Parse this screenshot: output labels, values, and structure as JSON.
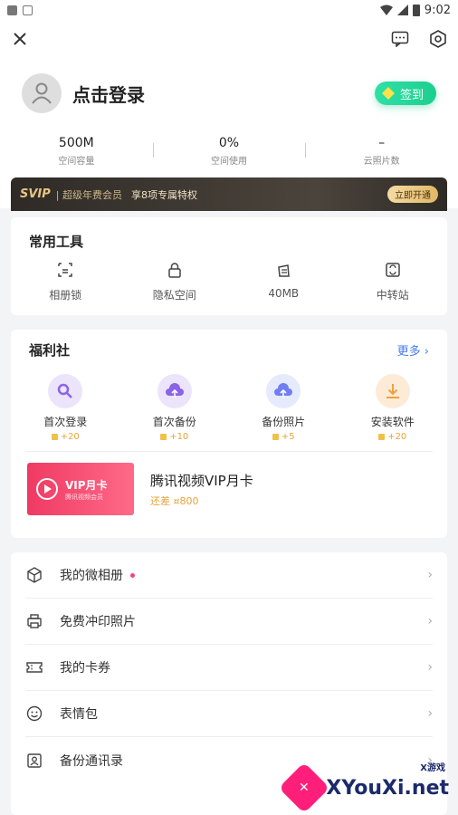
{
  "status_bar": {
    "time": "9:02"
  },
  "profile": {
    "login_text": "点击登录",
    "signin_label": "签到"
  },
  "stats": [
    {
      "value": "500M",
      "label": "空间容量"
    },
    {
      "value": "0%",
      "label": "空间使用"
    },
    {
      "value": "–",
      "label": "云照片数"
    }
  ],
  "svip": {
    "logo": "SVIP",
    "text1": "| 超级年费会员",
    "text2": "享8项专属特权",
    "button": "立即开通"
  },
  "tools": {
    "title": "常用工具",
    "items": [
      {
        "label": "相册锁",
        "icon": "album-lock-icon"
      },
      {
        "label": "隐私空间",
        "icon": "lock-icon"
      },
      {
        "label": "40MB",
        "icon": "clean-icon"
      },
      {
        "label": "中转站",
        "icon": "transfer-icon"
      }
    ]
  },
  "welfare": {
    "title": "福利社",
    "more": "更多",
    "items": [
      {
        "label": "首次登录",
        "points": "+20",
        "color": "#ece4fb",
        "icon_color": "#8b63e6"
      },
      {
        "label": "首次备份",
        "points": "+10",
        "color": "#ece4fb",
        "icon_color": "#8b63e6"
      },
      {
        "label": "备份照片",
        "points": "+5",
        "color": "#e6eafd",
        "icon_color": "#6f7ef0"
      },
      {
        "label": "安装软件",
        "points": "+20",
        "color": "#fdebd8",
        "icon_color": "#f0a13f"
      }
    ],
    "vip": {
      "card_title": "VIP月卡",
      "card_sub": "腾讯视频会员",
      "title": "腾讯视频VIP月卡",
      "need": "还差 ¤800"
    }
  },
  "menu": [
    {
      "label": "我的微相册",
      "icon": "cube-icon",
      "dot": true
    },
    {
      "label": "免费冲印照片",
      "icon": "printer-icon",
      "dot": false
    },
    {
      "label": "我的卡券",
      "icon": "ticket-icon",
      "dot": false
    },
    {
      "label": "表情包",
      "icon": "smiley-icon",
      "dot": false
    },
    {
      "label": "备份通讯录",
      "icon": "contacts-icon",
      "dot": false
    }
  ],
  "watermark": {
    "text": "XYouXi.net",
    "sub": "X游戏"
  }
}
